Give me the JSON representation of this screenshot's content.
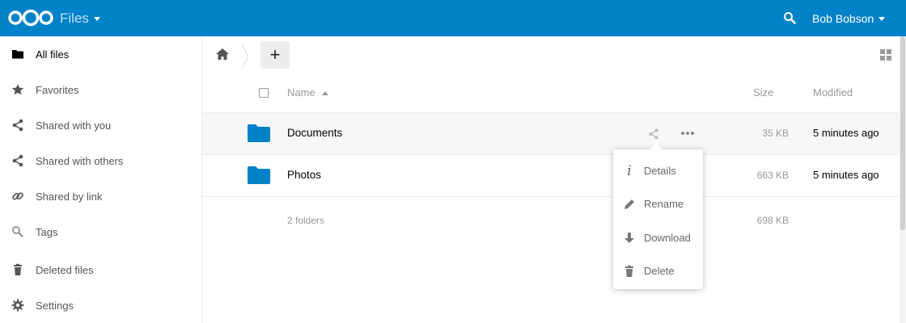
{
  "header": {
    "app_name": "Files",
    "user_name": "Bob Bobson",
    "brand_color": "#0082c9"
  },
  "sidebar": {
    "items": [
      {
        "label": "All files",
        "icon": "folder-icon"
      },
      {
        "label": "Favorites",
        "icon": "star-icon"
      },
      {
        "label": "Shared with you",
        "icon": "share-icon"
      },
      {
        "label": "Shared with others",
        "icon": "share-icon"
      },
      {
        "label": "Shared by link",
        "icon": "link-icon"
      },
      {
        "label": "Tags",
        "icon": "tag-search-icon"
      },
      {
        "label": "Deleted files",
        "icon": "trash-icon"
      },
      {
        "label": "Settings",
        "icon": "gear-icon"
      }
    ]
  },
  "controls": {
    "new_label": "+"
  },
  "table": {
    "columns": {
      "name": "Name",
      "size": "Size",
      "modified": "Modified"
    },
    "rows": [
      {
        "name": "Documents",
        "size": "35 KB",
        "modified": "5 minutes ago"
      },
      {
        "name": "Photos",
        "size": "663 KB",
        "modified": "5 minutes ago"
      }
    ],
    "summary": {
      "label": "2 folders",
      "size": "698 KB"
    }
  },
  "file_menu": {
    "items": [
      {
        "label": "Details",
        "icon": "info-icon"
      },
      {
        "label": "Rename",
        "icon": "pencil-icon"
      },
      {
        "label": "Download",
        "icon": "download-icon"
      },
      {
        "label": "Delete",
        "icon": "trash-icon"
      }
    ]
  }
}
